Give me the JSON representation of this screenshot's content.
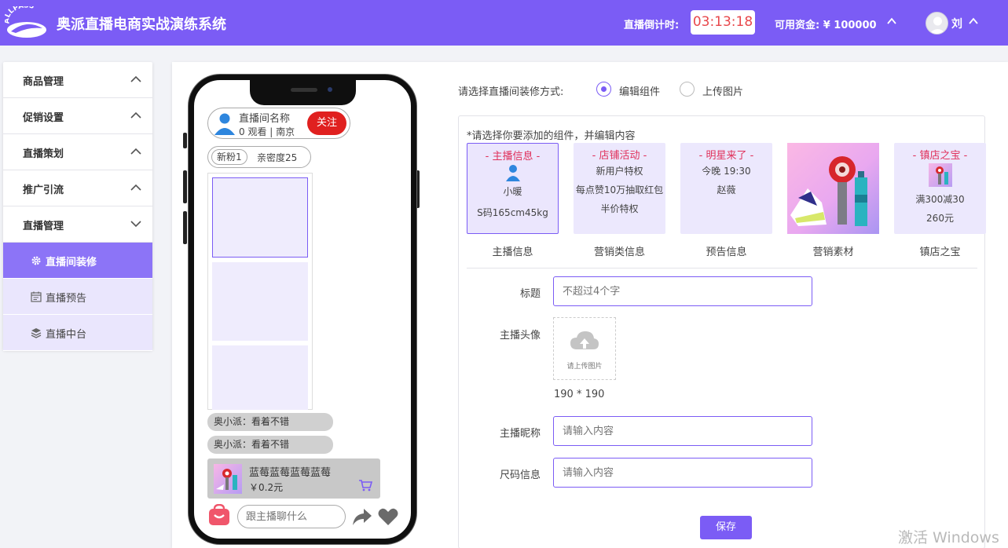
{
  "header": {
    "logo_text": "ALLPASS",
    "app_title": "奥派直播电商实战演练系统",
    "countdown_label": "直播倒计时:",
    "countdown_value": "03:13:18",
    "funds_text": "可用资金: ¥ 100000",
    "user_name": "刘"
  },
  "sidebar": {
    "groups": [
      {
        "label": "商品管理",
        "icon": "chevron-up-icon"
      },
      {
        "label": "促销设置",
        "icon": "chevron-up-icon"
      },
      {
        "label": "直播策划",
        "icon": "chevron-up-icon"
      },
      {
        "label": "推广引流",
        "icon": "chevron-up-icon"
      },
      {
        "label": "直播管理",
        "icon": "chevron-down-icon"
      }
    ],
    "subitems": [
      {
        "label": "直播间装修",
        "icon": "gear-icon",
        "active": true
      },
      {
        "label": "直播预告",
        "icon": "calendar-icon",
        "active": false
      },
      {
        "label": "直播中台",
        "icon": "layers-icon",
        "active": false
      }
    ]
  },
  "phone": {
    "host_name": "直播间名称",
    "host_stats": "0 观看 | 南京",
    "follow_label": "关注",
    "fans_badge": "新粉1",
    "intimacy": "亲密度25",
    "comments": [
      "奥小派：看着不错",
      "奥小派：看着不错"
    ],
    "product_name": "蓝莓蓝莓蓝莓蓝莓",
    "product_price": "￥0.2元",
    "chat_placeholder": "跟主播聊什么"
  },
  "config": {
    "mode_label": "请选择直播间装修方式:",
    "mode_options": [
      {
        "label": "编辑组件",
        "checked": true
      },
      {
        "label": "上传图片",
        "checked": false
      }
    ],
    "component_hint": "*请选择你要添加的组件，并编辑内容",
    "components": [
      {
        "title": "- 主播信息 -",
        "lines": [
          "小暖",
          "S码165cm45kg"
        ],
        "name": "主播信息",
        "selected": true
      },
      {
        "title": "- 店铺活动 -",
        "lines": [
          "新用户特权",
          "每点赞10万抽取红包",
          "半价特权"
        ],
        "name": "营销类信息",
        "selected": false
      },
      {
        "title": "- 明星来了 -",
        "lines": [
          "今晚 19:30",
          "赵薇"
        ],
        "name": "预告信息",
        "selected": false
      },
      {
        "title": "",
        "lines": [],
        "name": "营销素材",
        "selected": false
      },
      {
        "title": "- 镇店之宝 -",
        "lines": [
          "满300减30",
          "260元"
        ],
        "name": "镇店之宝",
        "selected": false
      }
    ],
    "form": {
      "title_label": "标题",
      "title_placeholder": "不超过4个字",
      "avatar_label": "主播头像",
      "upload_text": "请上传图片",
      "upload_size": "190 * 190",
      "nickname_label": "主播昵称",
      "nickname_placeholder": "请输入内容",
      "size_label": "尺码信息",
      "size_placeholder": "请输入内容",
      "save_label": "保存"
    }
  },
  "watermark": "激活 Windows",
  "colors": {
    "primary": "#7b5cf5",
    "accent_red": "#e0201f",
    "light_purple": "#ece8fd"
  }
}
